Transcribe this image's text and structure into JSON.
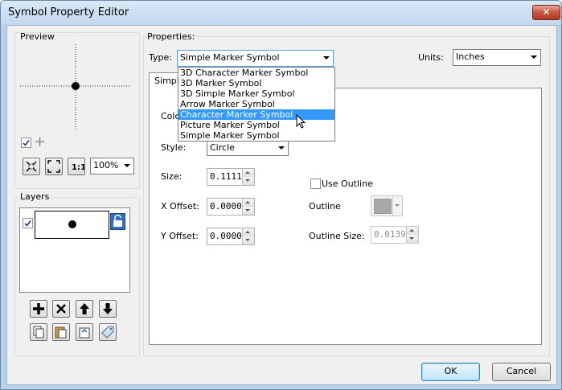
{
  "window": {
    "title": "Symbol Property Editor",
    "close_label": "x"
  },
  "preview": {
    "label": "Preview",
    "zoom_value": "100%"
  },
  "layers": {
    "label": "Layers"
  },
  "properties": {
    "label": "Properties:",
    "type_label": "Type:",
    "type_value": "Simple Marker Symbol",
    "units_label": "Units:",
    "units_value": "Inches",
    "type_options": [
      "3D Character Marker Symbol",
      "3D Marker Symbol",
      "3D Simple Marker Symbol",
      "Arrow Marker Symbol",
      "Character Marker Symbol",
      "Picture Marker Symbol",
      "Simple Marker Symbol"
    ],
    "highlighted_option": "Character Marker Symbol"
  },
  "tab": {
    "label": "Simple"
  },
  "form": {
    "color_label": "Colo",
    "style_label": "Style:",
    "style_value": "Circle",
    "size_label": "Size:",
    "size_value": "0.1111",
    "xoffset_label": "X Offset:",
    "xoffset_value": "0.0000",
    "yoffset_label": "Y Offset:",
    "yoffset_value": "0.0000",
    "use_outline_label": "Use Outline",
    "outline_label": "Outline",
    "outline_size_label": "Outline Size:",
    "outline_size_value": "0.0139",
    "outline_color": "#a8a8a8"
  },
  "buttons": {
    "ok": "OK",
    "cancel": "Cancel"
  },
  "colors": {
    "accent": "#3399ff",
    "title_bar": "#c2d7ee",
    "close": "#c6533f"
  }
}
